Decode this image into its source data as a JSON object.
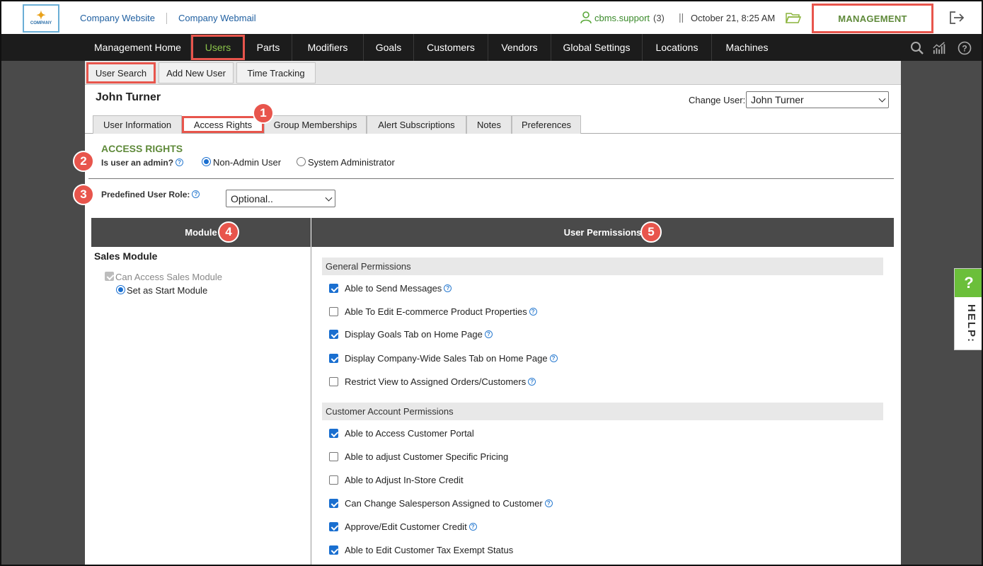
{
  "topbar": {
    "logo_text": "COMPANY",
    "links": [
      "Company Website",
      "Company Webmail"
    ],
    "user_name": "cbms.support",
    "user_count": "(3)",
    "datetime": "October 21, 8:25 AM",
    "management": "MANAGEMENT"
  },
  "nav": {
    "items": [
      "Management Home",
      "Users",
      "Parts",
      "Modifiers",
      "Goals",
      "Customers",
      "Vendors",
      "Global Settings",
      "Locations",
      "Machines"
    ],
    "active": "Users"
  },
  "subnav": {
    "items": [
      "User Search",
      "Add New User",
      "Time Tracking"
    ],
    "active": "User Search"
  },
  "user": {
    "name": "John Turner",
    "change_label": "Change User:",
    "selected": "John Turner"
  },
  "tabs": {
    "items": [
      "User Information",
      "Access Rights",
      "Group Memberships",
      "Alert Subscriptions",
      "Notes",
      "Preferences"
    ],
    "active": "Access Rights"
  },
  "badges": [
    "1",
    "2",
    "3",
    "4",
    "5"
  ],
  "access": {
    "heading": "ACCESS RIGHTS",
    "admin_label": "Is user an admin?",
    "option_non_admin": "Non-Admin User",
    "option_admin": "System Administrator",
    "selected": "Non-Admin User",
    "role_label": "Predefined User Role:",
    "role_value": "Optional.."
  },
  "table": {
    "col_module": "Module",
    "col_permissions": "User Permissions"
  },
  "module": {
    "title": "Sales Module",
    "access_label": "Can Access Sales Module",
    "access_checked": true,
    "start_label": "Set as Start Module",
    "start_selected": true
  },
  "permissions": {
    "general_title": "General Permissions",
    "general": [
      {
        "label": "Able to Send Messages",
        "checked": true,
        "help": true
      },
      {
        "label": "Able To Edit E-commerce Product Properties",
        "checked": false,
        "help": true
      },
      {
        "label": "Display Goals Tab on Home Page",
        "checked": true,
        "help": true
      },
      {
        "label": "Display Company-Wide Sales Tab on Home Page",
        "checked": true,
        "help": true
      },
      {
        "label": "Restrict View to Assigned Orders/Customers",
        "checked": false,
        "help": true
      }
    ],
    "customer_title": "Customer Account Permissions",
    "customer": [
      {
        "label": "Able to Access Customer Portal",
        "checked": true,
        "help": false
      },
      {
        "label": "Able to adjust Customer Specific Pricing",
        "checked": false,
        "help": false
      },
      {
        "label": "Able to Adjust In-Store Credit",
        "checked": false,
        "help": false
      },
      {
        "label": "Can Change Salesperson Assigned to Customer",
        "checked": true,
        "help": true
      },
      {
        "label": "Approve/Edit Customer Credit",
        "checked": true,
        "help": true
      },
      {
        "label": "Able to Edit Customer Tax Exempt Status",
        "checked": true,
        "help": false
      }
    ]
  },
  "help_widget": {
    "symbol": "?",
    "label": "HELP:"
  },
  "colors": {
    "accent_red": "#e8554c",
    "nav_active_green": "#8bc34a",
    "section_green": "#5f8a3a",
    "checkbox_blue": "#1a6fd0",
    "help_green": "#6bbf3a"
  }
}
